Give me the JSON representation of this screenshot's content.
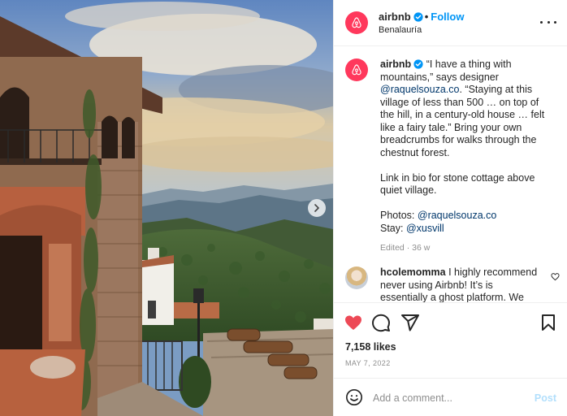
{
  "post": {
    "username": "airbnb",
    "follow_label": "Follow",
    "location": "Benalauría",
    "caption_quote": "“I have a thing with mountains,” says designer",
    "caption_mention1": "@raquelsouza.co",
    "caption_rest": ". “Staying at this village of less than 500 … on top of the hill, in a century-old house … felt like a fairy tale.” Bring your own breadcrumbs for walks through the chestnut forest.",
    "caption_link": "Link in bio for stone cottage above quiet village.",
    "photos_label": "Photos:",
    "photos_credit": "@raquelsouza.co",
    "stay_label": "Stay:",
    "stay_credit": "@xusvill",
    "edited": "Edited · 36 w",
    "likes": "7,158 likes",
    "date": "MAY 7, 2022"
  },
  "comment": {
    "username": "hcolemomma",
    "text": "I highly recommend never using Airbnb! It’s is essentially a ghost platform. We"
  },
  "composer": {
    "placeholder": "Add a comment...",
    "post_label": "Post"
  },
  "icons": {
    "more": "more-options-icon",
    "verified": "verified-badge-icon",
    "like": "heart-icon",
    "comment": "comment-icon",
    "share": "share-icon",
    "save": "bookmark-icon",
    "emoji": "emoji-icon",
    "next": "chevron-right-icon"
  },
  "colors": {
    "brand": "#ff385c",
    "link": "#0095f6",
    "mention": "#00376b",
    "like": "#ed4956",
    "post_disabled": "#b2dffc"
  }
}
